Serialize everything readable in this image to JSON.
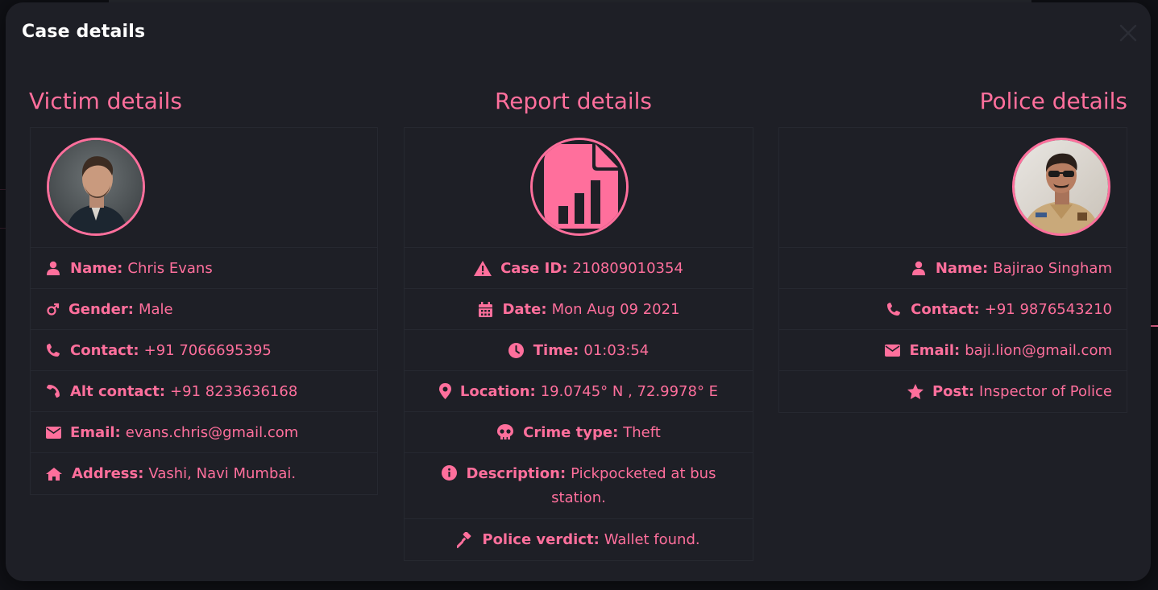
{
  "modal": {
    "title": "Case details"
  },
  "victim": {
    "heading": "Victim details",
    "fields": [
      {
        "icon": "user-icon",
        "label": "Name:",
        "value": "Chris Evans"
      },
      {
        "icon": "mars-icon",
        "label": "Gender:",
        "value": "Male"
      },
      {
        "icon": "phone-icon",
        "label": "Contact:",
        "value": "+91 7066695395"
      },
      {
        "icon": "phone-alt-icon",
        "label": "Alt contact:",
        "value": "+91 8233636168"
      },
      {
        "icon": "envelope-icon",
        "label": "Email:",
        "value": "evans.chris@gmail.com"
      },
      {
        "icon": "home-icon",
        "label": "Address:",
        "value": "Vashi, Navi Mumbai."
      }
    ]
  },
  "report": {
    "heading": "Report details",
    "fields": [
      {
        "icon": "warning-icon",
        "label": "Case ID:",
        "value": "210809010354"
      },
      {
        "icon": "calendar-icon",
        "label": "Date:",
        "value": "Mon Aug 09 2021"
      },
      {
        "icon": "clock-icon",
        "label": "Time:",
        "value": "01:03:54"
      },
      {
        "icon": "map-marker-icon",
        "label": "Location:",
        "value": "19.0745° N , 72.9978° E"
      },
      {
        "icon": "skull-icon",
        "label": "Crime type:",
        "value": "Theft"
      },
      {
        "icon": "info-icon",
        "label": "Description:",
        "value": "Pickpocketed at bus",
        "value2": "station."
      },
      {
        "icon": "gavel-icon",
        "label": "Police verdict:",
        "value": "Wallet found."
      }
    ]
  },
  "police": {
    "heading": "Police details",
    "fields": [
      {
        "icon": "user-icon",
        "label": "Name:",
        "value": "Bajirao Singham"
      },
      {
        "icon": "phone-icon",
        "label": "Contact:",
        "value": "+91 9876543210"
      },
      {
        "icon": "envelope-icon",
        "label": "Email:",
        "value": "baji.lion@gmail.com"
      },
      {
        "icon": "star-icon",
        "label": "Post:",
        "value": "Inspector of Police"
      }
    ]
  },
  "colors": {
    "accent": "#ff6f9c",
    "modal_bg": "#1e1f26",
    "title": "#ffffff"
  }
}
